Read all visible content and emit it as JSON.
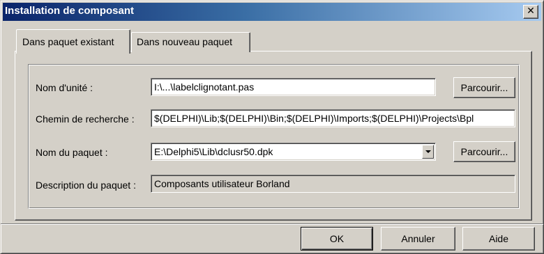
{
  "window": {
    "title": "Installation de composant",
    "close_symbol": "✕"
  },
  "tabs": [
    {
      "label": "Dans paquet existant",
      "active": true
    },
    {
      "label": "Dans nouveau paquet",
      "active": false
    }
  ],
  "form": {
    "unit_name": {
      "label": "Nom d'unité :",
      "value": "I:\\...\\labelclignotant.pas",
      "browse_label": "Parcourir..."
    },
    "search_path": {
      "label": "Chemin de recherche :",
      "value": "$(DELPHI)\\Lib;$(DELPHI)\\Bin;$(DELPHI)\\Imports;$(DELPHI)\\Projects\\Bpl"
    },
    "package_name": {
      "label": "Nom du paquet :",
      "value": "E:\\Delphi5\\Lib\\dclusr50.dpk",
      "browse_label": "Parcourir..."
    },
    "package_description": {
      "label": "Description du paquet :",
      "value": "Composants utilisateur Borland"
    }
  },
  "buttons": {
    "ok": "OK",
    "cancel": "Annuler",
    "help": "Aide"
  },
  "colors": {
    "face": "#d4d0c8",
    "title_start": "#0a246a",
    "title_end": "#a6caf0"
  },
  "icons": {
    "close": "close-icon",
    "combo": "chevron-down-icon"
  }
}
